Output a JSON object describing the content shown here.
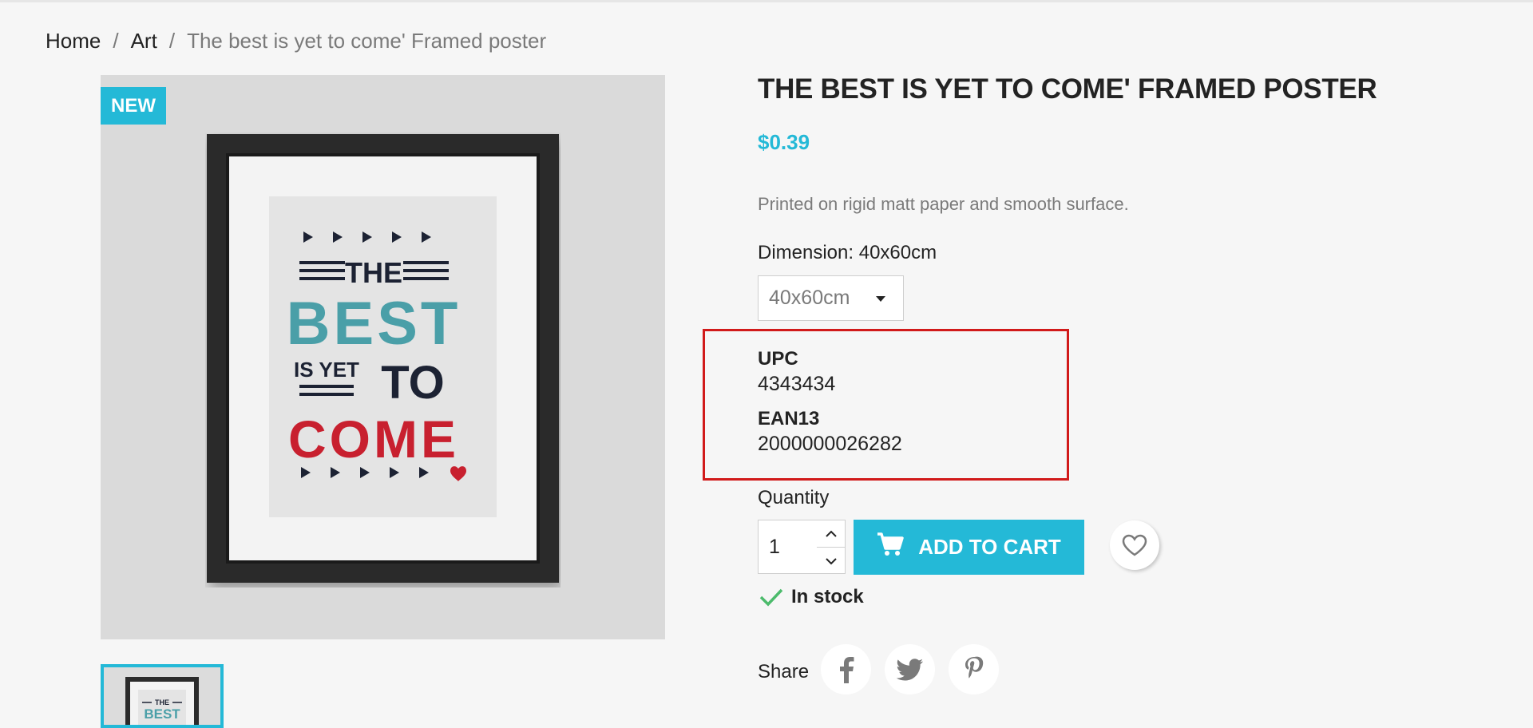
{
  "breadcrumb": {
    "items": [
      "Home",
      "Art",
      "The best is yet to come' Framed poster"
    ],
    "separator": "/"
  },
  "product": {
    "badge": "NEW",
    "title": "THE BEST IS YET TO COME' FRAMED POSTER",
    "price": "$0.39",
    "description": "Printed on rigid matt paper and smooth surface.",
    "dimension_label": "Dimension: 40x60cm",
    "dimension_selected": "40x60cm",
    "poster_art": {
      "line1": "THE",
      "line2": "BEST",
      "line3": "IS YET",
      "line4": "TO",
      "line5": "COME"
    },
    "specs": {
      "upc_label": "UPC",
      "upc_value": "4343434",
      "ean_label": "EAN13",
      "ean_value": "2000000026282"
    },
    "quantity_label": "Quantity",
    "quantity_value": "1",
    "add_to_cart": "ADD TO CART",
    "stock_status": "In stock",
    "share_label": "Share"
  },
  "icons": {
    "cart": "cart-icon",
    "heart": "heart-icon",
    "check": "check-icon",
    "facebook": "facebook-icon",
    "twitter": "twitter-icon",
    "pinterest": "pinterest-icon"
  },
  "colors": {
    "accent": "#24b9d7",
    "highlight": "#d11a1a",
    "stock_check": "#4cbb6c",
    "poster_teal": "#4a9fa8",
    "poster_red": "#c8202f",
    "poster_navy": "#1c2233"
  }
}
